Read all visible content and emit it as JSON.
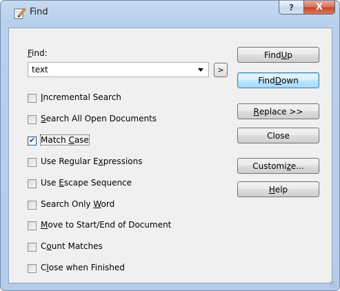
{
  "window": {
    "title": "Find"
  },
  "caption_buttons": {
    "help": "?",
    "close": "X"
  },
  "find": {
    "label_mnemonic": "F",
    "label_rest": "ind:",
    "value": "text",
    "next_button": ">"
  },
  "options": [
    {
      "pre": "",
      "mn": "I",
      "post": "ncremental Search",
      "checked": false
    },
    {
      "pre": "",
      "mn": "S",
      "post": "earch All Open Documents",
      "checked": false
    },
    {
      "pre": "Match ",
      "mn": "C",
      "post": "ase",
      "checked": true
    },
    {
      "pre": "Use Regular E",
      "mn": "x",
      "post": "pressions",
      "checked": false
    },
    {
      "pre": "Use ",
      "mn": "E",
      "post": "scape Sequence",
      "checked": false
    },
    {
      "pre": "Search Only ",
      "mn": "W",
      "post": "ord",
      "checked": false
    },
    {
      "pre": "",
      "mn": "M",
      "post": "ove to Start/End of Document",
      "checked": false
    },
    {
      "pre": "C",
      "mn": "o",
      "post": "unt Matches",
      "checked": false
    },
    {
      "pre": "C",
      "mn": "l",
      "post": "ose when Finished",
      "checked": false
    }
  ],
  "buttons": {
    "find_up": {
      "pre": "Find ",
      "mn": "U",
      "post": "p"
    },
    "find_down": {
      "pre": "Find ",
      "mn": "D",
      "post": "own"
    },
    "replace": {
      "pre": "",
      "mn": "R",
      "post": "eplace >>"
    },
    "close": {
      "pre": "Close",
      "mn": "",
      "post": ""
    },
    "customize": {
      "pre": "Customi",
      "mn": "z",
      "post": "e..."
    },
    "help": {
      "pre": "",
      "mn": "H",
      "post": "elp"
    }
  },
  "icons": {
    "title": "notepad-pencil-icon",
    "combo": "chevron-down-icon"
  }
}
